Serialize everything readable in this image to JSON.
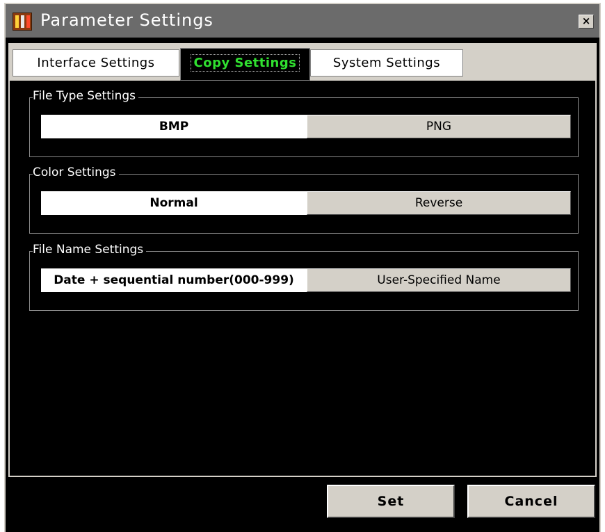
{
  "window": {
    "title": "Parameter Settings",
    "icon": "tools-icon",
    "close_glyph": "×"
  },
  "tabs": [
    {
      "label": "Interface Settings",
      "active": false
    },
    {
      "label": "Copy Settings",
      "active": true
    },
    {
      "label": "System Settings",
      "active": false
    }
  ],
  "groups": {
    "file_type": {
      "legend": "File Type Settings",
      "selected": "BMP",
      "other": "PNG"
    },
    "color": {
      "legend": "Color Settings",
      "selected": "Normal",
      "other": "Reverse"
    },
    "file_name": {
      "legend": "File Name Settings",
      "selected": "Date + sequential number(000-999)",
      "other": "User-Specified Name"
    }
  },
  "buttons": {
    "set": "Set",
    "cancel": "Cancel"
  },
  "colors": {
    "active_tab_text": "#30e030",
    "titlebar": "#6b6b6b",
    "background": "#000000"
  }
}
